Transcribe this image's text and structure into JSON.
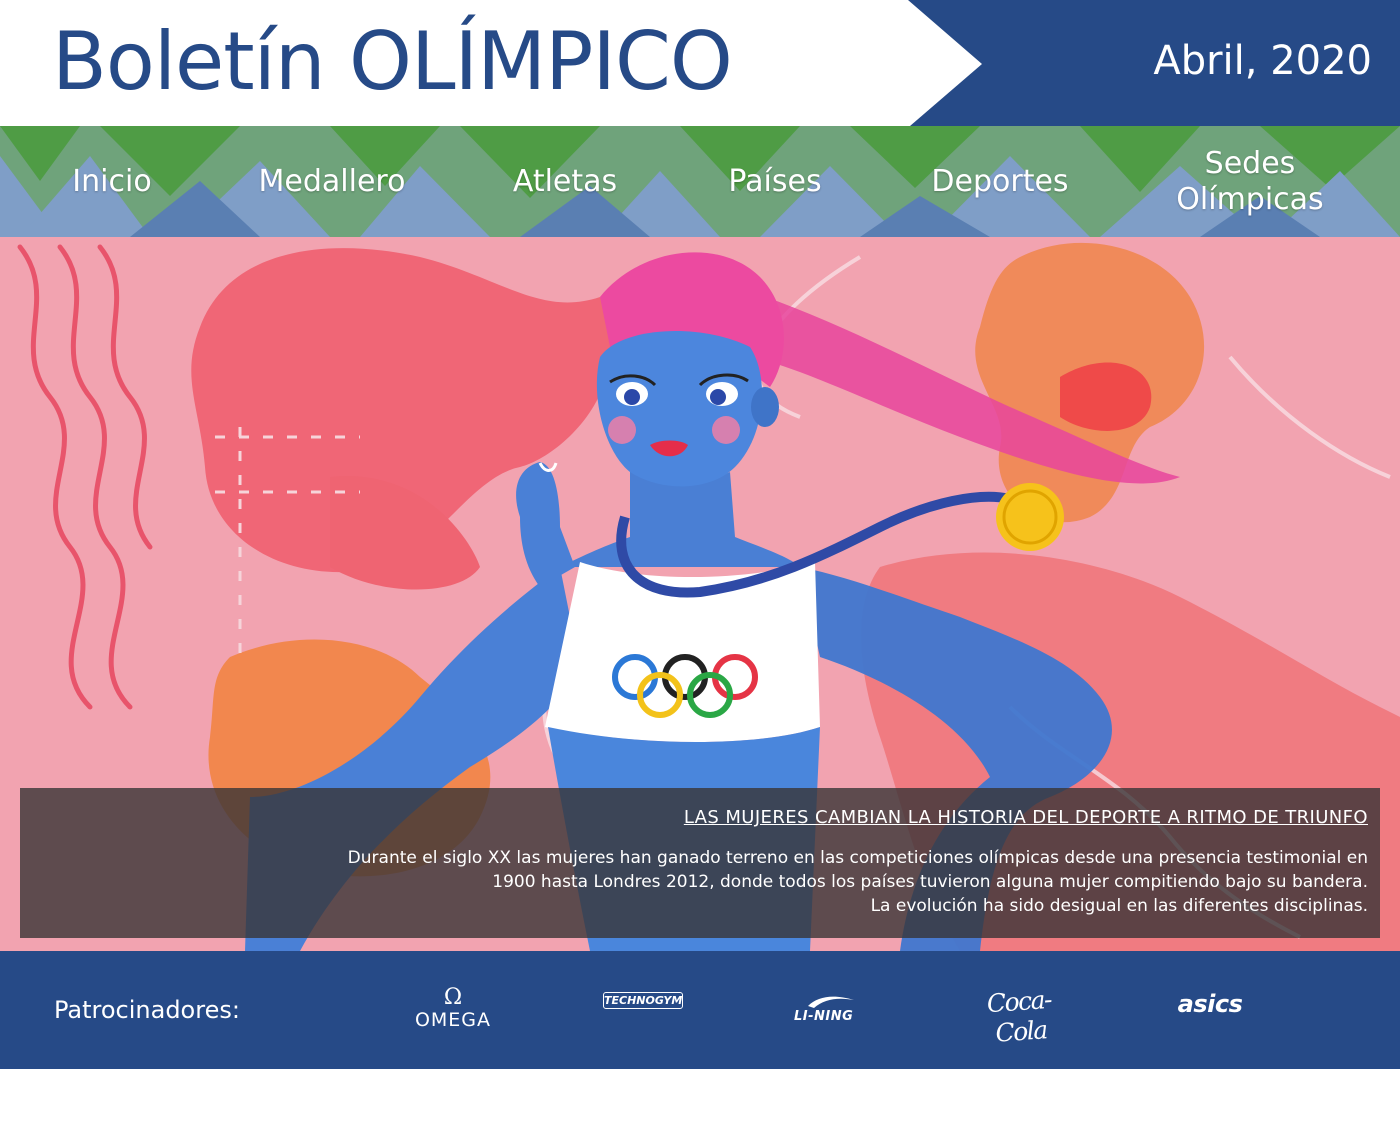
{
  "header": {
    "title": "Boletín OLÍMPICO",
    "date": "Abril, 2020"
  },
  "nav": {
    "items": [
      {
        "label": "Inicio"
      },
      {
        "label": "Medallero"
      },
      {
        "label": "Atletas"
      },
      {
        "label": "Países"
      },
      {
        "label": "Deportes"
      },
      {
        "label_line1": "Sedes",
        "label_line2": "Olímpicas"
      }
    ]
  },
  "hero": {
    "headline": "LAS MUJERES CAMBIAN LA HISTORIA DEL DEPORTE A RITMO DE TRIUNFO",
    "body_lines": [
      "Durante el siglo XX las mujeres han ganado terreno en las competiciones olímpicas desde una presencia testimonial en",
      "1900 hasta Londres 2012, donde todos los países tuvieron alguna mujer compitiendo bajo su bandera.",
      "La evolución ha sido desigual en las diferentes disciplinas."
    ]
  },
  "sponsors": {
    "label": "Patrocinadores:",
    "logos": {
      "omega_symbol": "Ω",
      "omega": "OMEGA",
      "technogym": "TECHNOGYM",
      "lining": "LI-NING",
      "cocacola": "Coca-Cola",
      "asics": "asics"
    }
  },
  "colors": {
    "brand_blue": "#264a87",
    "nav_green": "#4f9c45",
    "nav_steel": "#6f8fbd",
    "hero_pink": "#f2a0ae",
    "caption_bg": "#383436"
  }
}
